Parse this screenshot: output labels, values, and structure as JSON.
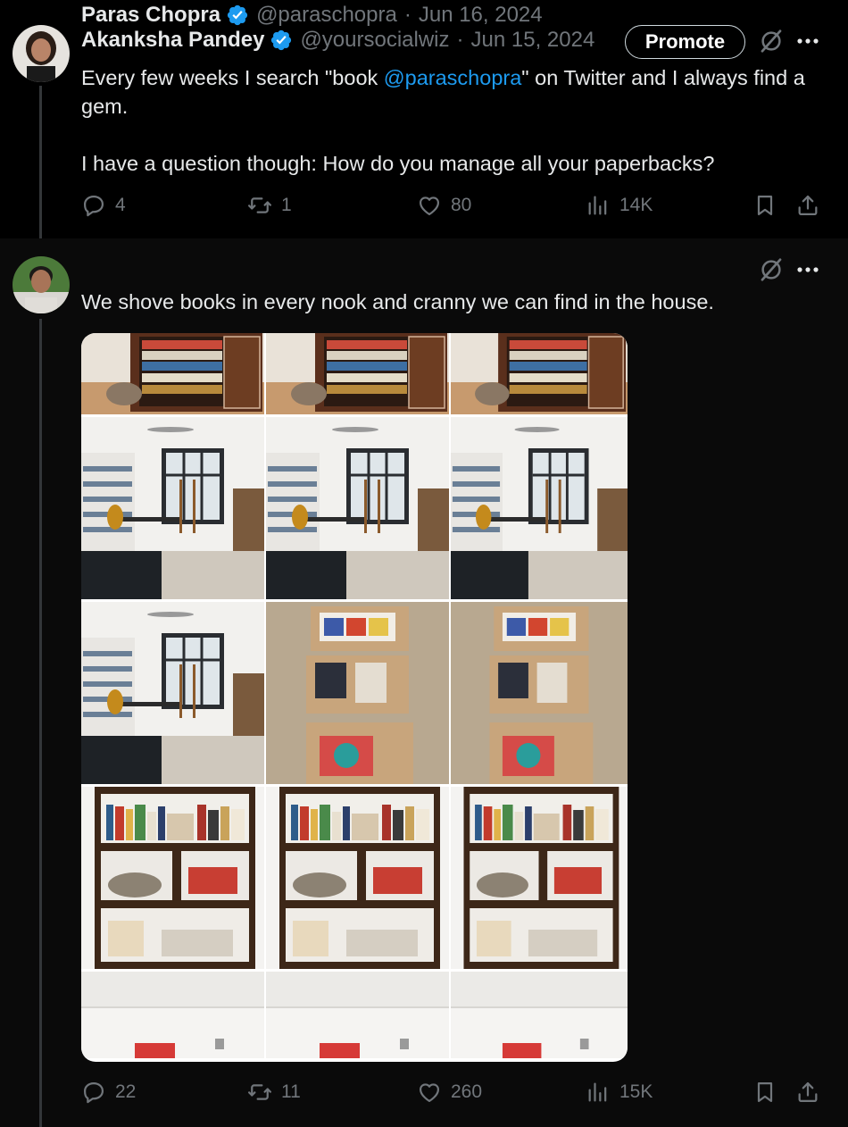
{
  "tweets": [
    {
      "author": "Akanksha Pandey",
      "handle": "@yoursocialwiz",
      "date": "Jun 15, 2024",
      "promote_label": "Promote",
      "text_before": "Every few weeks I search \"book ",
      "mention": "@paraschopra",
      "text_after": "\" on Twitter and I always find a gem.",
      "text_line2": "I have a question though: How do you manage all your paperbacks?",
      "stats": {
        "replies": "4",
        "reposts": "1",
        "likes": "80",
        "views": "14K"
      }
    },
    {
      "author": "Paras Chopra",
      "handle": "@paraschopra",
      "date": "Jun 16, 2024",
      "text": "We shove books in every nook and cranny we can find in the house.",
      "stats": {
        "replies": "22",
        "reposts": "11",
        "likes": "260",
        "views": "15K"
      }
    }
  ],
  "separator": "·",
  "icons": {
    "verified": "verified-badge-icon",
    "grok": "grok-icon",
    "more": "more-icon",
    "reply": "reply-icon",
    "repost": "repost-icon",
    "like": "like-icon",
    "views": "views-icon",
    "bookmark": "bookmark-icon",
    "share": "share-icon"
  },
  "colors": {
    "background": "#000000",
    "text": "#e7e9ea",
    "muted": "#71767b",
    "accent": "#1d9bf0",
    "verified": "#1d9bf0"
  }
}
